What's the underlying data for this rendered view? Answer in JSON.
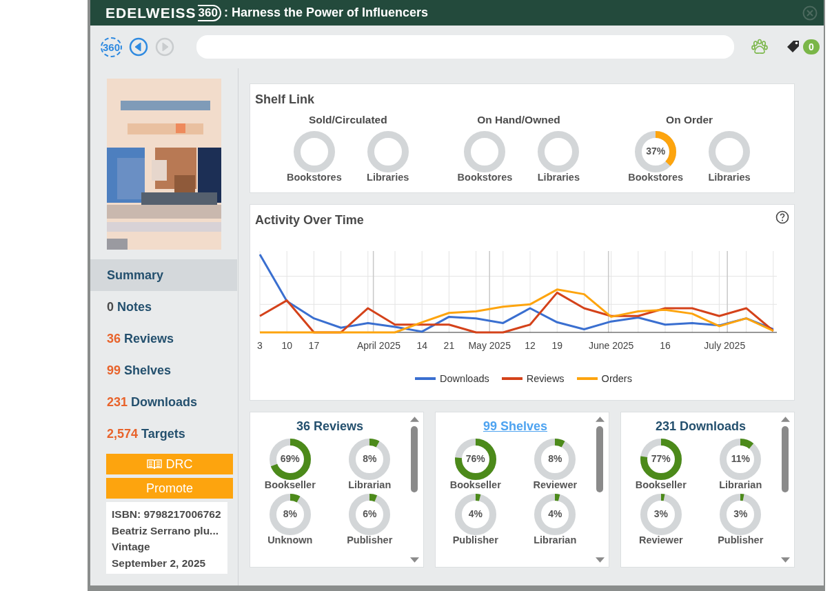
{
  "window": {
    "logo": "EDELWEISS",
    "logo_mark": "360",
    "title": ": Harness the Power of Influencers"
  },
  "toolbar": {
    "home_label": "360",
    "back_disabled": false,
    "forward_disabled": true,
    "tag_count": "0"
  },
  "sidebar": {
    "items": [
      {
        "label": "Summary",
        "selected": true
      },
      {
        "count": "0",
        "label": "Notes",
        "selected": false,
        "color": "#4a4a4a"
      },
      {
        "count": "36",
        "label": "Reviews",
        "selected": false,
        "color": "#e8632b"
      },
      {
        "count": "99",
        "label": "Shelves",
        "selected": false,
        "color": "#e8632b"
      },
      {
        "count": "231",
        "label": "Downloads",
        "selected": false,
        "color": "#e8632b"
      },
      {
        "count": "2,574",
        "label": "Targets",
        "selected": false,
        "color": "#e8632b"
      }
    ],
    "buttons": [
      {
        "label": "DRC",
        "kind": "book"
      },
      {
        "label": "Promote",
        "kind": "plain"
      }
    ],
    "info": [
      "ISBN: 9798217006762",
      "Beatriz Serrano plu...",
      "Vintage",
      "September 2, 2025"
    ]
  },
  "shelf_link": {
    "title": "Shelf Link",
    "groups": [
      {
        "title": "Sold/Circulated",
        "donuts": [
          {
            "label": "Bookstores",
            "level": 0
          },
          {
            "label": "Libraries",
            "level": 0
          }
        ]
      },
      {
        "title": "On Hand/Owned",
        "donuts": [
          {
            "label": "Bookstores",
            "level": 0
          },
          {
            "label": "Libraries",
            "level": 0
          }
        ]
      },
      {
        "title": "On Order",
        "donuts": [
          {
            "label": "Bookstores",
            "level": 0.37,
            "value": "37%"
          },
          {
            "label": "Libraries",
            "level": 0
          }
        ]
      }
    ]
  },
  "activity": {
    "title": "Activity Over Time",
    "x_labels": [
      "3",
      "10",
      "17",
      "April 2025",
      "14",
      "21",
      "May 2025",
      "12",
      "19",
      "June 2025",
      "16",
      "July 2025"
    ],
    "legend": [
      {
        "name": "Downloads",
        "color": "#3a6fd0"
      },
      {
        "name": "Reviews",
        "color": "#d4421a"
      },
      {
        "name": "Orders",
        "color": "#fda40e"
      }
    ]
  },
  "breakdowns": [
    {
      "title": "36 Reviews",
      "link": false,
      "donuts": [
        {
          "label": "Bookseller",
          "level": 0.69,
          "value": "69%"
        },
        {
          "label": "Librarian",
          "level": 0.08,
          "value": "8%"
        },
        {
          "label": "Unknown",
          "level": 0.08,
          "value": "8%"
        },
        {
          "label": "Publisher",
          "level": 0.06,
          "value": "6%"
        }
      ]
    },
    {
      "title": "99 Shelves",
      "link": true,
      "donuts": [
        {
          "label": "Bookseller",
          "level": 0.76,
          "value": "76%"
        },
        {
          "label": "Reviewer",
          "level": 0.08,
          "value": "8%"
        },
        {
          "label": "Publisher",
          "level": 0.04,
          "value": "4%"
        },
        {
          "label": "Librarian",
          "level": 0.04,
          "value": "4%"
        }
      ]
    },
    {
      "title": "231 Downloads",
      "link": false,
      "donuts": [
        {
          "label": "Bookseller",
          "level": 0.77,
          "value": "77%"
        },
        {
          "label": "Librarian",
          "level": 0.11,
          "value": "11%"
        },
        {
          "label": "Reviewer",
          "level": 0.03,
          "value": "3%"
        },
        {
          "label": "Publisher",
          "level": 0.03,
          "value": "3%"
        }
      ]
    }
  ]
}
